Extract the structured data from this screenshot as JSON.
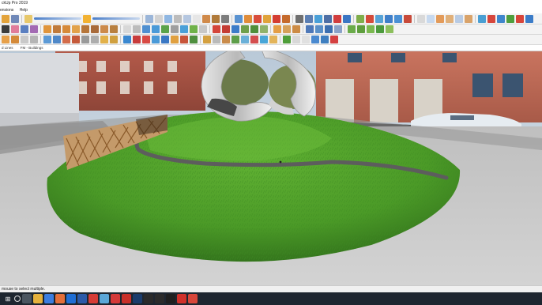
{
  "window": {
    "title": "ckUp Pro 2019"
  },
  "menu": {
    "items": [
      "ensions",
      "Help"
    ]
  },
  "statusline": {
    "left": "d Lines",
    "right": "FM - Buildings"
  },
  "bottom_status": {
    "hint": "mouse to select multiple."
  },
  "scene": {
    "description_layer": "SketchUp 3D model with grass mound, path, sculpture and fence on photo background"
  },
  "colors": {
    "toolbar_bg": "#f3f3f3",
    "taskbar_bg": "#1e2630",
    "grass": "#4f9a2a",
    "path": "#6a6a6a"
  },
  "toolbars": {
    "row1": [
      "section-plane",
      "shadow-slider",
      "fog",
      "styles",
      "views",
      "camera",
      "tape",
      "protractor",
      "axes",
      "dimensions",
      "text",
      "3d-text",
      "sandbox",
      "match-photo",
      "layers",
      "scenes",
      "components",
      "materials",
      "outliner",
      "entity-info",
      "extension-warehouse",
      "solid-tools"
    ],
    "row2": [
      "select",
      "eraser",
      "paint",
      "line",
      "arc",
      "freehand",
      "rectangle",
      "circle",
      "polygon",
      "push-pull",
      "follow-me",
      "offset",
      "move",
      "rotate",
      "scale",
      "orbit",
      "pan",
      "zoom",
      "zoom-extents",
      "walk",
      "look-around",
      "position-camera",
      "sandbox-from-contours",
      "smoove",
      "stamp",
      "drape",
      "add-detail",
      "flip-edge"
    ]
  },
  "taskbar": {
    "items": [
      "start",
      "search",
      "task-view",
      "file-explorer",
      "chrome",
      "store",
      "mail",
      "photos",
      "sketchup",
      "layout",
      "style-builder",
      "acrobat",
      "calendar",
      "excel",
      "powerpoint",
      "word",
      "misc"
    ]
  }
}
